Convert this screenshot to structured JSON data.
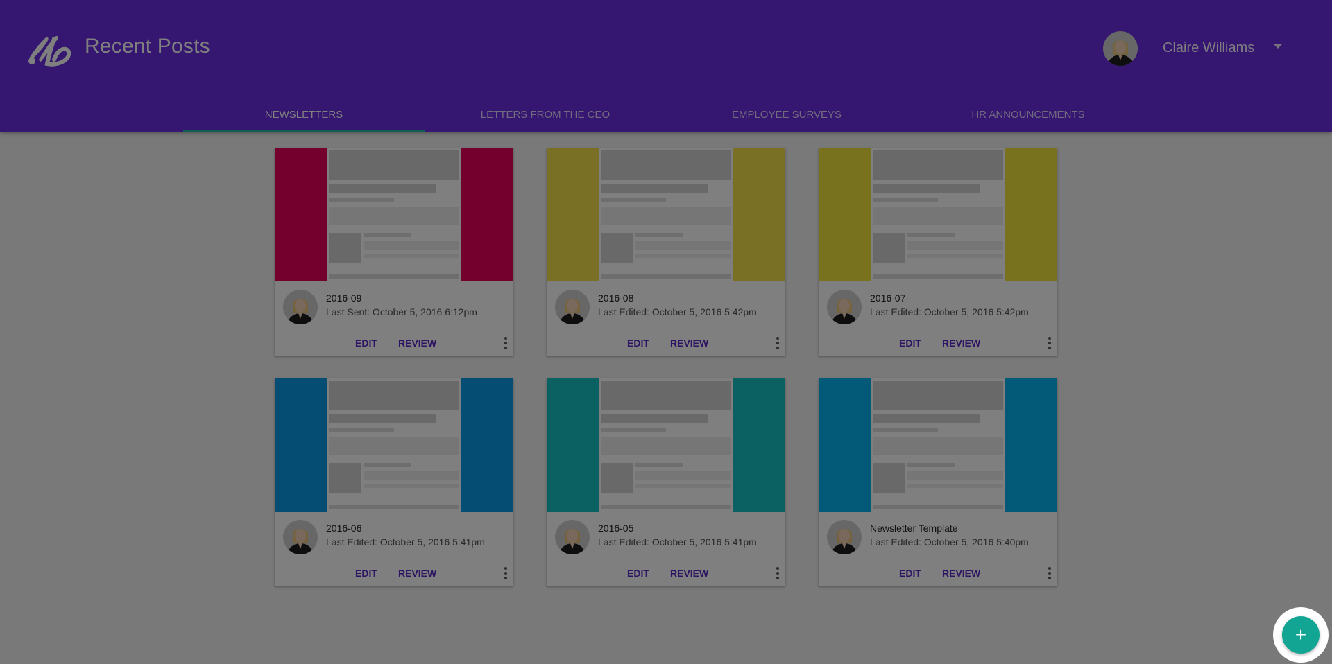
{
  "header": {
    "title": "Recent Posts",
    "user_name": "Claire Williams",
    "brand_color": "#6a2ce0"
  },
  "tabs": [
    {
      "label": "NEWSLETTERS",
      "active": true
    },
    {
      "label": "LETTERS FROM THE CEO",
      "active": false
    },
    {
      "label": "EMPLOYEE SURVEYS",
      "active": false
    },
    {
      "label": "HR ANNOUNCEMENTS",
      "active": false
    }
  ],
  "cards": [
    {
      "title": "2016-09",
      "subtitle": "Last Sent: October 5, 2016 6:12pm",
      "color": "#e8005a",
      "edit_label": "EDIT",
      "review_label": "REVIEW"
    },
    {
      "title": "2016-08",
      "subtitle": "Last Edited: October 5, 2016 5:42pm",
      "color": "#f3e04a",
      "edit_label": "EDIT",
      "review_label": "REVIEW"
    },
    {
      "title": "2016-07",
      "subtitle": "Last Edited: October 5, 2016 5:42pm",
      "color": "#f0e43c",
      "edit_label": "EDIT",
      "review_label": "REVIEW"
    },
    {
      "title": "2016-06",
      "subtitle": "Last Edited: October 5, 2016 5:41pm",
      "color": "#0a9be6",
      "edit_label": "EDIT",
      "review_label": "REVIEW"
    },
    {
      "title": "2016-05",
      "subtitle": "Last Edited: October 5, 2016 5:41pm",
      "color": "#16c2c2",
      "edit_label": "EDIT",
      "review_label": "REVIEW"
    },
    {
      "title": "Newsletter Template",
      "subtitle": "Last Edited: October 5, 2016 5:40pm",
      "color": "#05b2f0",
      "edit_label": "EDIT",
      "review_label": "REVIEW"
    }
  ],
  "fab": {
    "label": "+",
    "color": "#12a594"
  },
  "icons": {
    "logo": "brush-b-logo-icon",
    "avatar": "user-avatar",
    "caret": "chevron-down-icon",
    "more": "more-vert-icon",
    "add": "plus-icon"
  }
}
